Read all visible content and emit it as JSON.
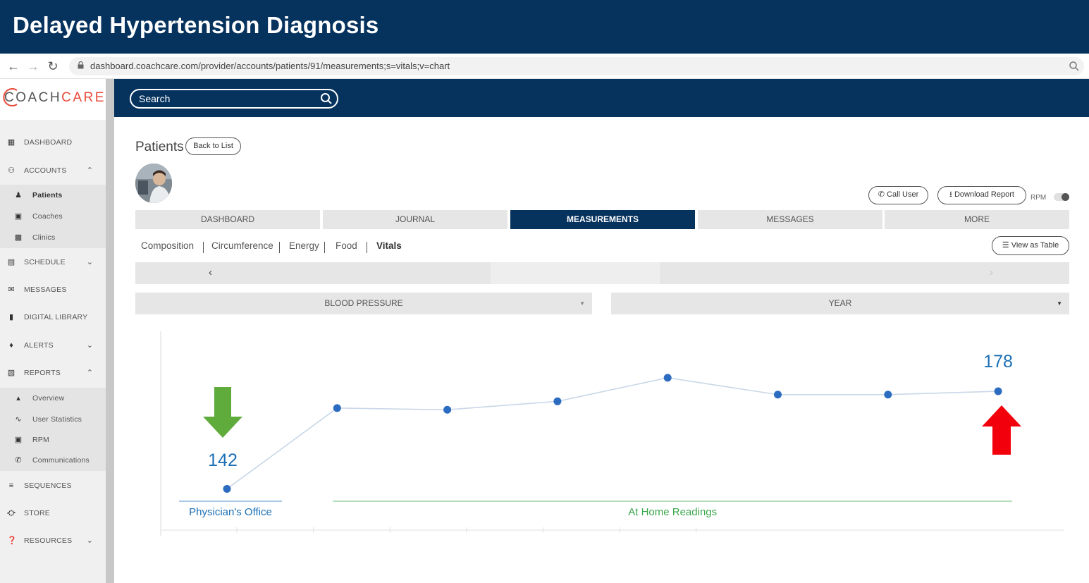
{
  "banner": {
    "title": "Delayed Hypertension Diagnosis"
  },
  "browser": {
    "url": "dashboard.coachcare.com/provider/accounts/patients/91/measurements;s=vitals;v=chart"
  },
  "logo": {
    "part1": "COACH",
    "part2": "CARE"
  },
  "sidebar": {
    "items": [
      {
        "label": "DASHBOARD",
        "icon": "dashboard-icon",
        "chevron": ""
      },
      {
        "label": "ACCOUNTS",
        "icon": "people-icon",
        "chevron": "up"
      },
      {
        "label": "Patients",
        "icon": "person-icon",
        "sub": true,
        "active": true
      },
      {
        "label": "Coaches",
        "icon": "badge-icon",
        "sub": true
      },
      {
        "label": "Clinics",
        "icon": "building-icon",
        "sub": true
      },
      {
        "label": "SCHEDULE",
        "icon": "calendar-icon",
        "chevron": "down"
      },
      {
        "label": "MESSAGES",
        "icon": "message-icon",
        "chevron": ""
      },
      {
        "label": "DIGITAL LIBRARY",
        "icon": "folder-icon",
        "chevron": ""
      },
      {
        "label": "ALERTS",
        "icon": "bell-icon",
        "chevron": "down"
      },
      {
        "label": "REPORTS",
        "icon": "report-icon",
        "chevron": "up"
      },
      {
        "label": "Overview",
        "icon": "overview-icon",
        "sub": true
      },
      {
        "label": "User Statistics",
        "icon": "trend-icon",
        "sub": true
      },
      {
        "label": "RPM",
        "icon": "calculator-icon",
        "sub": true
      },
      {
        "label": "Communications",
        "icon": "phone-icon",
        "sub": true
      },
      {
        "label": "SEQUENCES",
        "icon": "sequence-icon",
        "chevron": ""
      },
      {
        "label": "STORE",
        "icon": "cart-icon",
        "chevron": ""
      },
      {
        "label": "RESOURCES",
        "icon": "help-icon",
        "chevron": "down"
      }
    ]
  },
  "appbar": {
    "search_placeholder": "Search"
  },
  "patient": {
    "title": "Patients",
    "back_label": "Back to List",
    "call_label": "Call User",
    "download_label": "Download Report",
    "rpm_label": "RPM"
  },
  "tabs": [
    {
      "label": "DASHBOARD",
      "active": false
    },
    {
      "label": "JOURNAL",
      "active": false
    },
    {
      "label": "MEASUREMENTS",
      "active": true
    },
    {
      "label": "MESSAGES",
      "active": false
    },
    {
      "label": "MORE",
      "active": false
    }
  ],
  "subnav": {
    "items": [
      {
        "label": "Composition",
        "active": false
      },
      {
        "label": "Circumference",
        "active": false
      },
      {
        "label": "Energy",
        "active": false
      },
      {
        "label": "Food",
        "active": false
      },
      {
        "label": "Vitals",
        "active": true
      }
    ],
    "view_table_label": "View as Table"
  },
  "filters": {
    "metric": "BLOOD PRESSURE",
    "period": "YEAR"
  },
  "chart_data": {
    "type": "line",
    "series": [
      {
        "values": [
          142,
          166,
          165.5,
          168,
          175,
          170,
          170,
          171
        ]
      }
    ],
    "annotations": [
      {
        "text": "142",
        "point_index": 0,
        "color": "#1b6fb5",
        "arrow": "down",
        "arrow_color": "#5fab3c"
      },
      {
        "text": "178",
        "point_index": 7,
        "color": "#1b6fb5",
        "arrow": "up",
        "arrow_color": "#f2000c"
      }
    ],
    "group_labels": [
      {
        "text": "Physician's Office",
        "from_index": 0,
        "to_index": 0,
        "color": "#1b6fb5"
      },
      {
        "text": "At Home Readings",
        "from_index": 1,
        "to_index": 7,
        "color": "#3aa64c"
      }
    ],
    "point_color": "#2c6cc0",
    "line_color": "#c9d7e8",
    "grid": false
  }
}
